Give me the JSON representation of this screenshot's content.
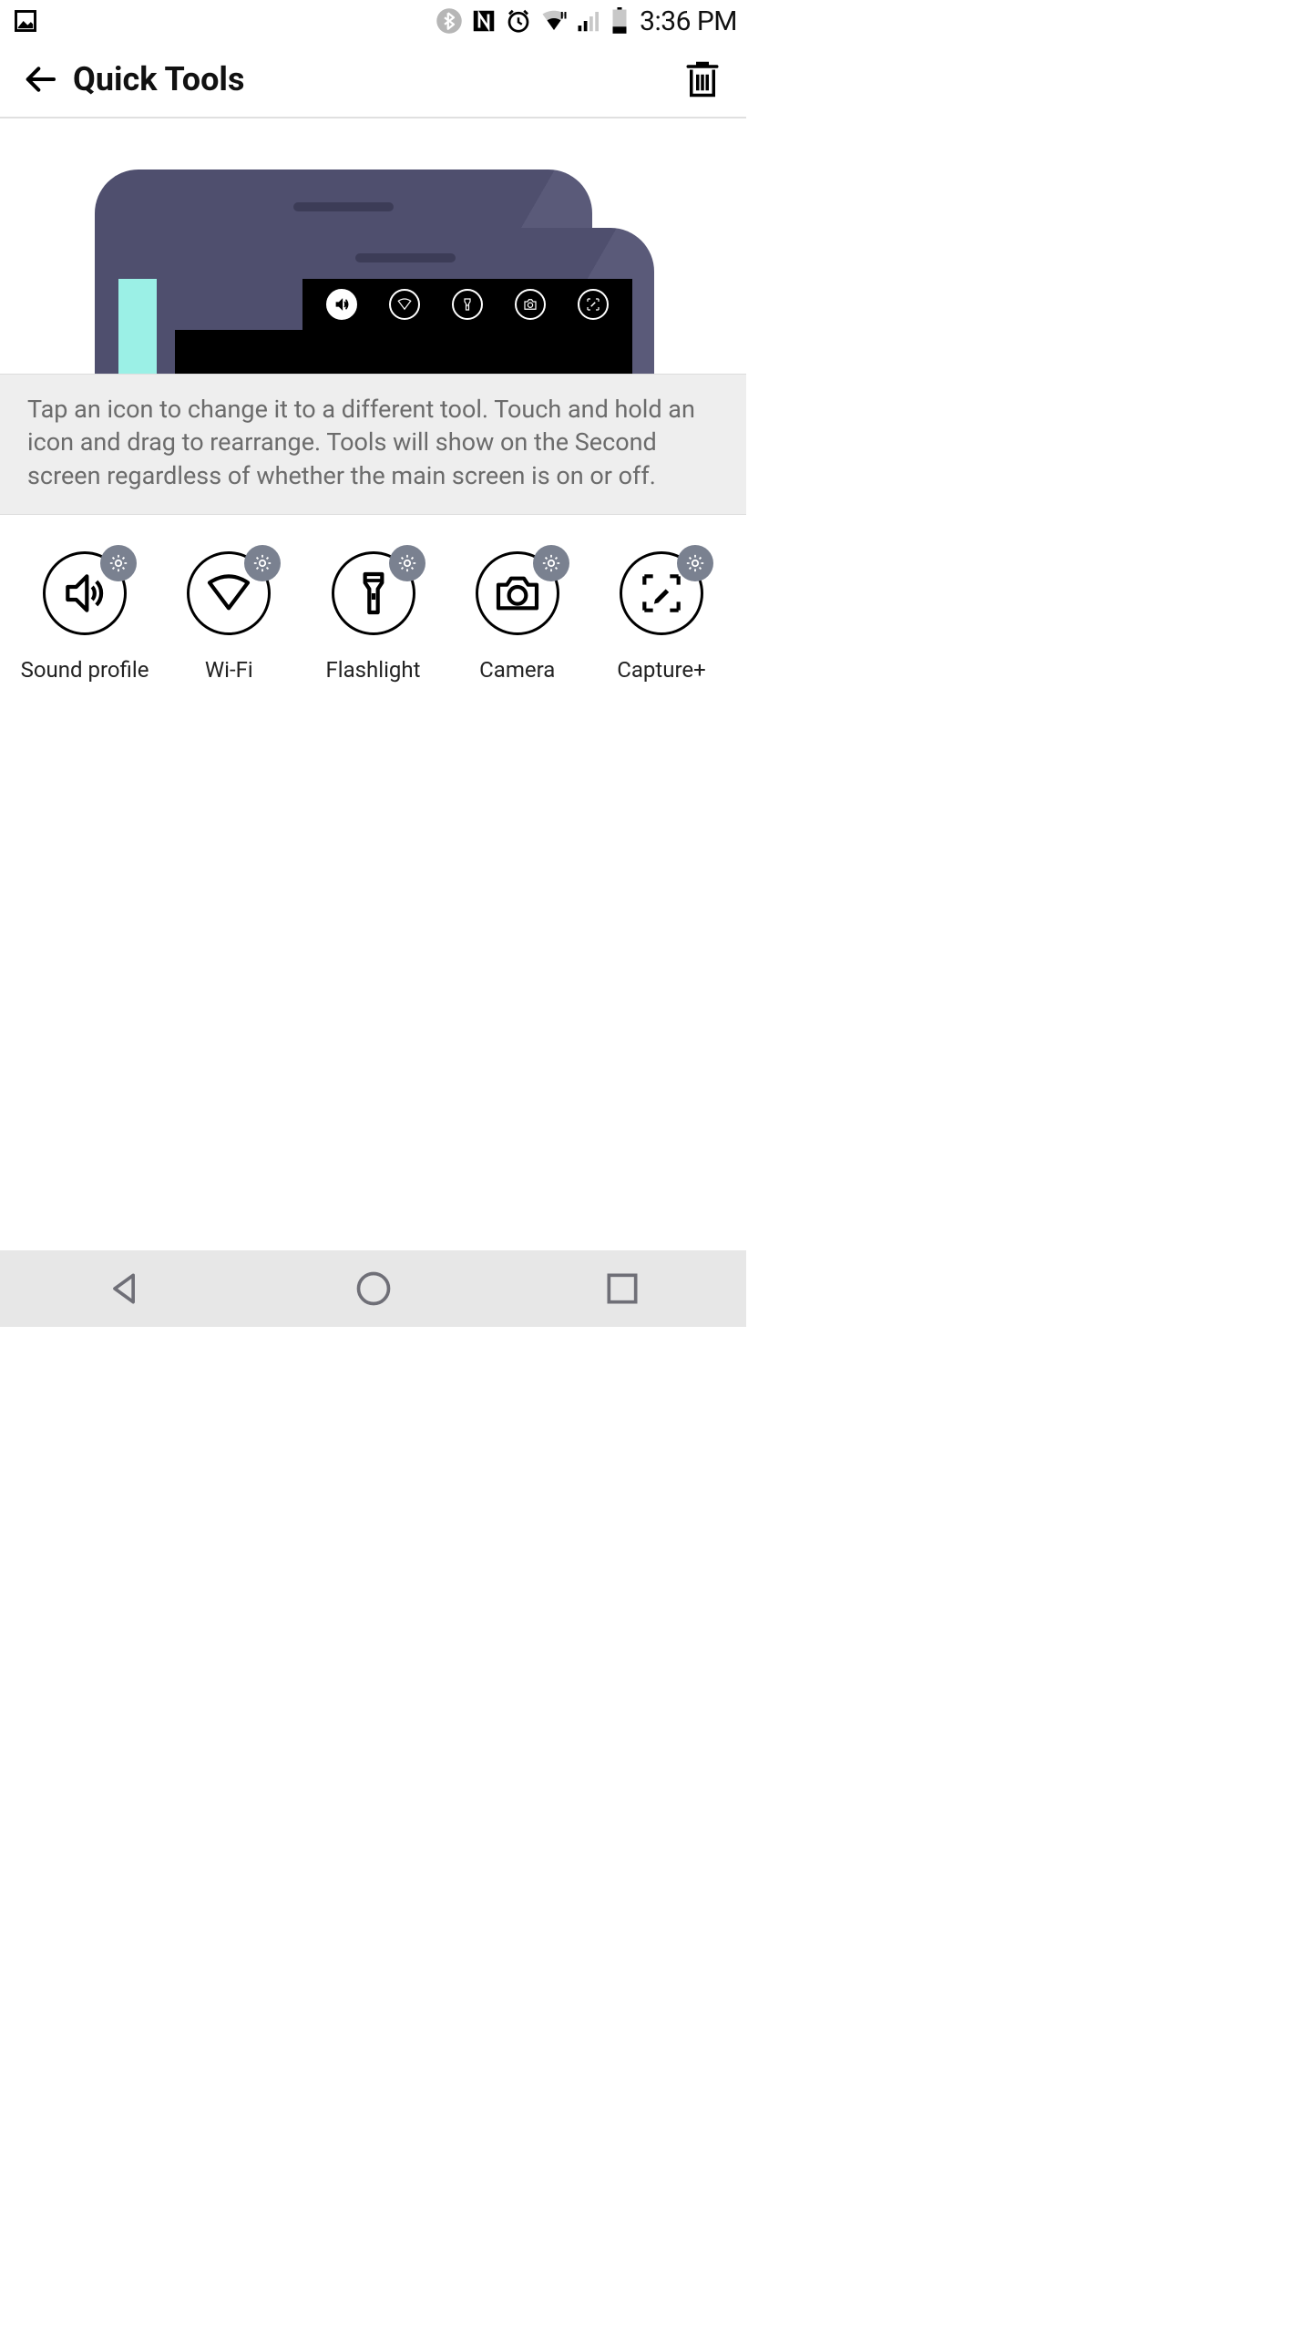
{
  "status": {
    "time": "3:36 PM"
  },
  "header": {
    "title": "Quick Tools"
  },
  "instruction": "Tap an icon to change it to a different tool. Touch and hold an icon and drag to rearrange. Tools will show on the Second screen regardless of whether the main screen is on or off.",
  "tools": [
    {
      "id": "sound-profile",
      "label": "Sound profile",
      "icon": "sound-icon"
    },
    {
      "id": "wifi",
      "label": "Wi-Fi",
      "icon": "wifi-icon"
    },
    {
      "id": "flashlight",
      "label": "Flashlight",
      "icon": "flashlight-icon"
    },
    {
      "id": "camera",
      "label": "Camera",
      "icon": "camera-icon"
    },
    {
      "id": "capture-plus",
      "label": "Capture+",
      "icon": "capture-plus-icon"
    }
  ],
  "preview_icons": [
    "sound-icon",
    "wifi-icon",
    "flashlight-icon",
    "camera-icon",
    "capture-plus-icon"
  ],
  "preview_selected": 0
}
